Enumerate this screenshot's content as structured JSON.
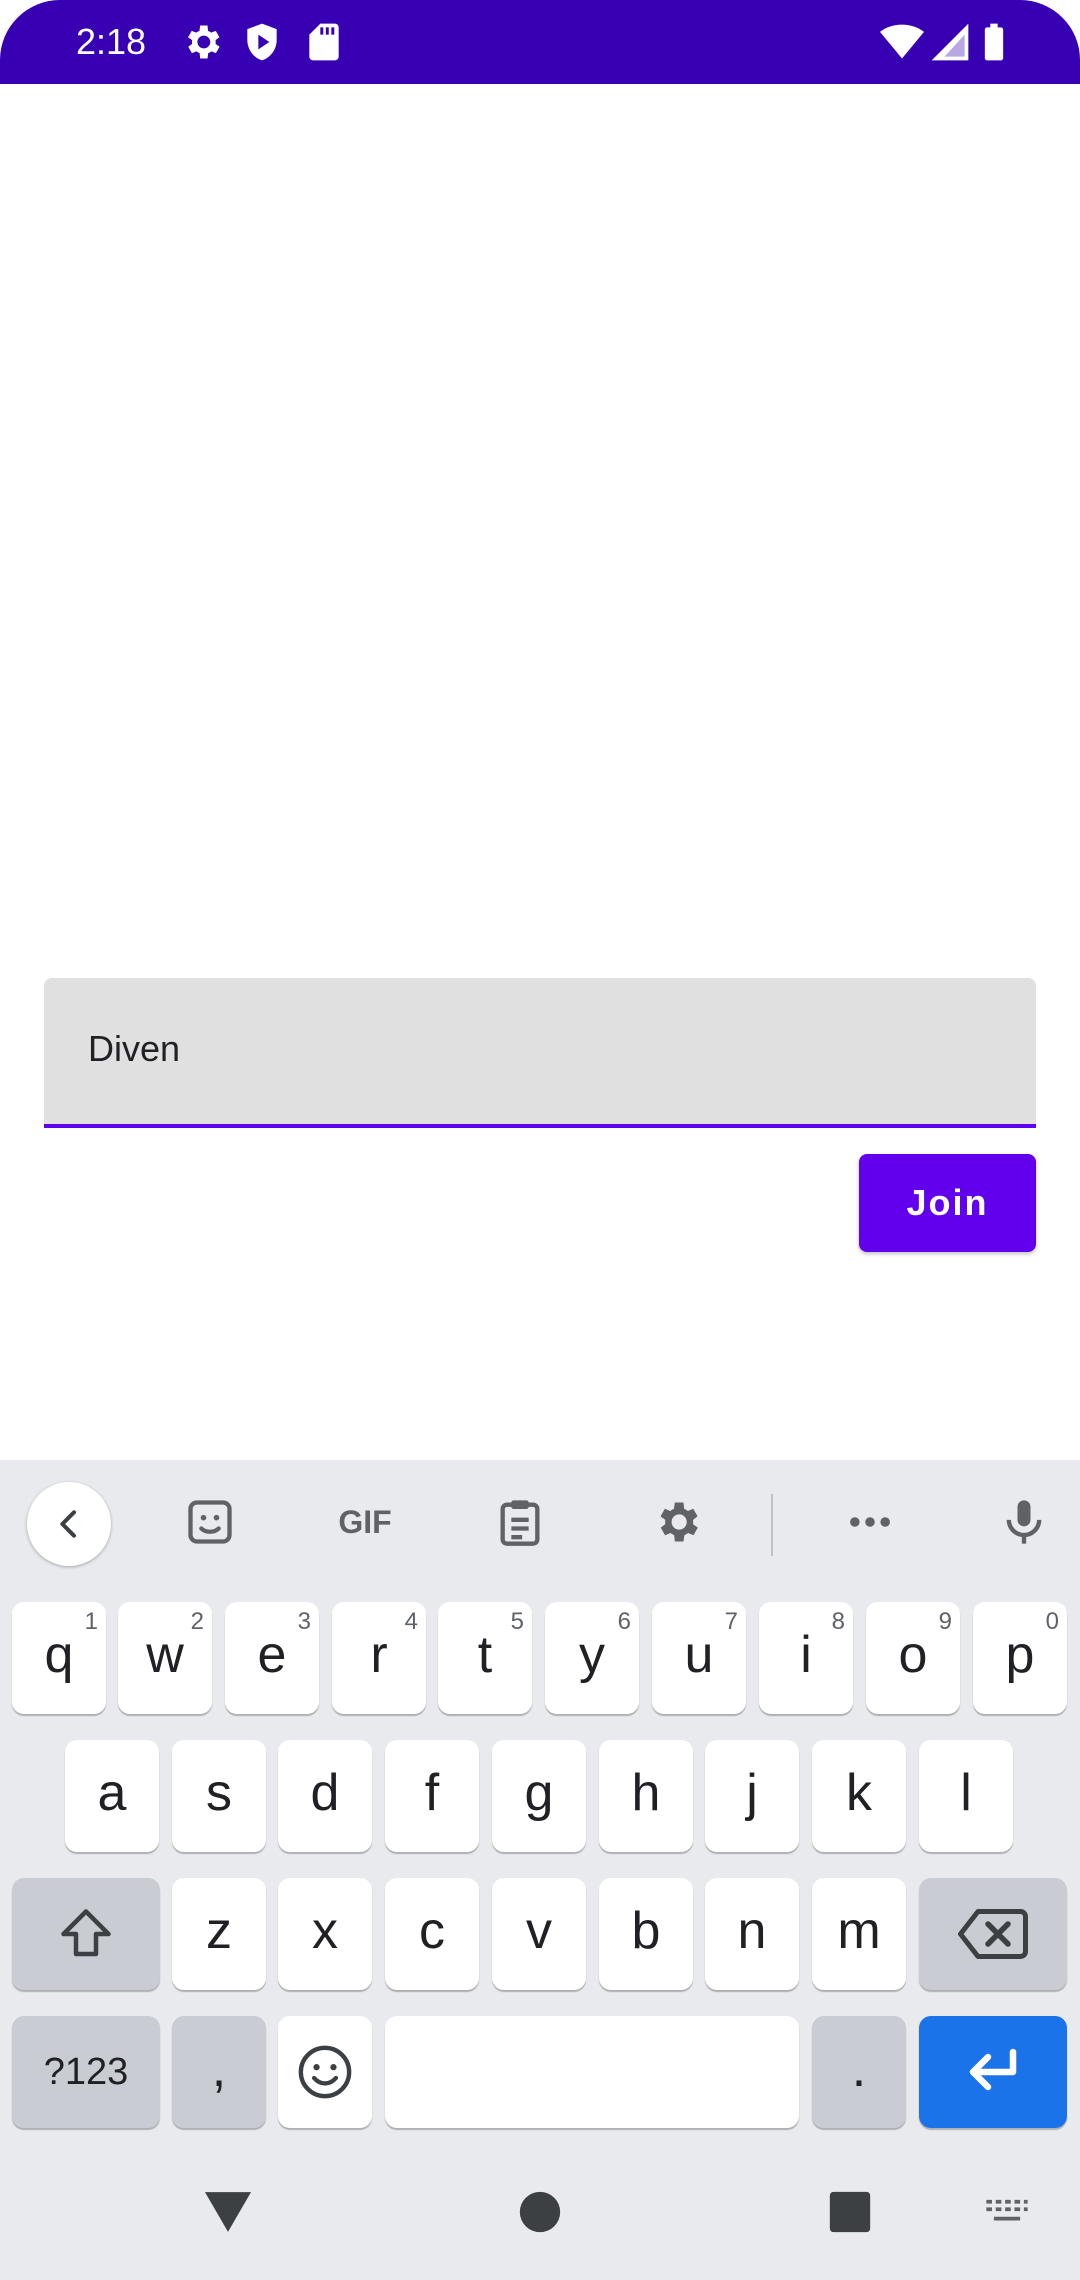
{
  "status_bar": {
    "time": "2:18",
    "icons": [
      "settings-icon",
      "shield-play-icon",
      "sd-card-icon",
      "wifi-icon",
      "signal-icon",
      "battery-icon"
    ],
    "background": "#3700b3"
  },
  "form": {
    "name_value": "Diven",
    "join_label": "Join",
    "accent": "#6200ee"
  },
  "keyboard": {
    "toolbar": {
      "gif_label": "GIF",
      "icons": [
        "back-chevron-icon",
        "sticker-icon",
        "gif-icon",
        "clipboard-icon",
        "gear-icon",
        "more-icon",
        "mic-icon"
      ]
    },
    "row1": [
      {
        "key": "q",
        "hint": "1"
      },
      {
        "key": "w",
        "hint": "2"
      },
      {
        "key": "e",
        "hint": "3"
      },
      {
        "key": "r",
        "hint": "4"
      },
      {
        "key": "t",
        "hint": "5"
      },
      {
        "key": "y",
        "hint": "6"
      },
      {
        "key": "u",
        "hint": "7"
      },
      {
        "key": "i",
        "hint": "8"
      },
      {
        "key": "o",
        "hint": "9"
      },
      {
        "key": "p",
        "hint": "0"
      }
    ],
    "row2": [
      "a",
      "s",
      "d",
      "f",
      "g",
      "h",
      "j",
      "k",
      "l"
    ],
    "row3": [
      "z",
      "x",
      "c",
      "v",
      "b",
      "n",
      "m"
    ],
    "row4": {
      "symbols_label": "?123",
      "comma": ",",
      "period": "."
    }
  },
  "nav_bar": {
    "icons": [
      "back-triangle-icon",
      "home-circle-icon",
      "recents-square-icon",
      "keyboard-switch-icon"
    ]
  }
}
